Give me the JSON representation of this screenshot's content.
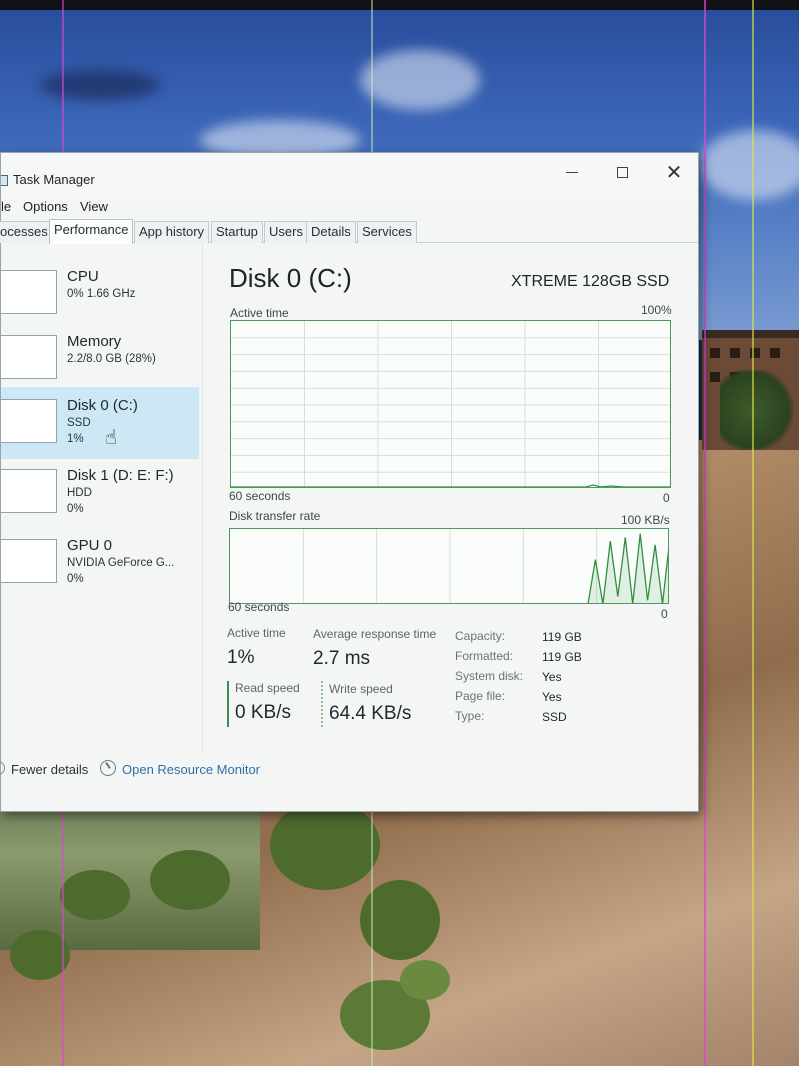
{
  "window": {
    "title": "Task Manager",
    "controls": {
      "minimize": "—",
      "maximize": "☐",
      "close": "✕"
    }
  },
  "menu": [
    "le",
    "Options",
    "View"
  ],
  "tabs": [
    "ocesses",
    "Performance",
    "App history",
    "Startup",
    "Users",
    "Details",
    "Services"
  ],
  "active_tab": "Performance",
  "sidebar": {
    "items": [
      {
        "name": "CPU",
        "line1": "0% 1.66 GHz",
        "line2": ""
      },
      {
        "name": "Memory",
        "line1": "2.2/8.0 GB (28%)",
        "line2": ""
      },
      {
        "name": "Disk 0 (C:)",
        "line1": "SSD",
        "line2": "1%"
      },
      {
        "name": "Disk 1 (D: E: F:)",
        "line1": "HDD",
        "line2": "0%"
      },
      {
        "name": "GPU 0",
        "line1": "NVIDIA GeForce G...",
        "line2": "0%"
      }
    ],
    "selected_index": 2
  },
  "main": {
    "title": "Disk 0 (C:)",
    "model": "XTREME 128GB SSD",
    "active_time_graph": {
      "label": "Active time",
      "max_label": "100%",
      "time_label": "60 seconds",
      "min_label": "0"
    },
    "transfer_graph": {
      "label": "Disk transfer rate",
      "max_label": "100 KB/s",
      "time_label": "60 seconds",
      "min_label": "0"
    },
    "stats": {
      "active_time_label": "Active time",
      "active_time_value": "1%",
      "avg_response_label": "Average response time",
      "avg_response_value": "2.7 ms",
      "read_label": "Read speed",
      "read_value": "0 KB/s",
      "write_label": "Write speed",
      "write_value": "64.4 KB/s"
    },
    "properties": [
      {
        "label": "Capacity:",
        "value": "119 GB"
      },
      {
        "label": "Formatted:",
        "value": "119 GB"
      },
      {
        "label": "System disk:",
        "value": "Yes"
      },
      {
        "label": "Page file:",
        "value": "Yes"
      },
      {
        "label": "Type:",
        "value": "SSD"
      }
    ]
  },
  "footer": {
    "fewer_details": "Fewer details",
    "open_resource_monitor": "Open Resource Monitor"
  },
  "chart_data": {
    "type": "line",
    "title": "Disk transfer rate",
    "ylabel": "",
    "xlabel": "60 seconds",
    "ylim": [
      0,
      100
    ],
    "series": [
      {
        "values": [
          0,
          0,
          0,
          0,
          0,
          0,
          0,
          0,
          0,
          0,
          0,
          0,
          0,
          0,
          0,
          0,
          0,
          0,
          0,
          0,
          0,
          0,
          0,
          0,
          0,
          0,
          0,
          0,
          0,
          0,
          0,
          0,
          0,
          0,
          0,
          0,
          0,
          0,
          0,
          0,
          0,
          0,
          0,
          0,
          0,
          0,
          0,
          0,
          0,
          60,
          0,
          85,
          10,
          90,
          0,
          95,
          5,
          80,
          0,
          90
        ]
      }
    ]
  },
  "colors": {
    "graph_border": "#4c9a59",
    "graph_line": "#2f8f3f",
    "graph_grid": "#cfe3d4",
    "selection": "#cde8f5",
    "read_bar": "#3e8d4e",
    "write_bar": "#8fc49a"
  },
  "icons": {
    "cursor": "hand-pointer-icon",
    "fewer_details": "chevron-up-icon",
    "resource_monitor": "resource-monitor-icon"
  }
}
